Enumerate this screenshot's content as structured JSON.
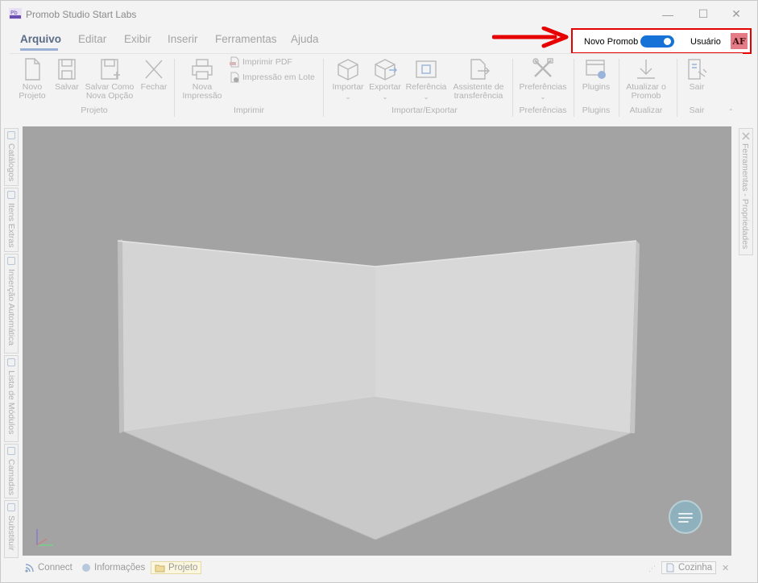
{
  "window": {
    "title": "Promob Studio Start Labs",
    "logo_text": "Pb",
    "min_glyph": "—",
    "max_glyph": "☐",
    "close_glyph": "✕"
  },
  "menu": {
    "tabs": [
      "Arquivo",
      "Editar",
      "Exibir",
      "Inserir",
      "Ferramentas",
      "Ajuda"
    ],
    "active": "Arquivo"
  },
  "header_right": {
    "novo_promob_label": "Novo Promob",
    "toggle_on": true,
    "user_label": "Usuário",
    "avatar_initials": "AF",
    "highlight_color": "#e60000",
    "toggle_color": "#1672d6"
  },
  "ribbon": {
    "groups": {
      "projeto": "Projeto",
      "imprimir": "Imprimir",
      "importar_exportar": "Importar/Exportar",
      "preferencias": "Preferências",
      "plugins": "Plugins",
      "atualizar": "Atualizar",
      "sair": "Sair"
    },
    "buttons": {
      "novo_projeto": [
        "Novo",
        "Projeto"
      ],
      "salvar": "Salvar",
      "salvar_como": [
        "Salvar Como",
        "Nova Opção"
      ],
      "fechar": "Fechar",
      "nova_impressao": [
        "Nova",
        "Impressão"
      ],
      "imprimir_pdf": "Imprimir PDF",
      "impressao_lote": "Impressão em Lote",
      "importar": "Importar",
      "exportar": "Exportar",
      "referencia": "Referência",
      "assistente": [
        "Assistente de",
        "transferência"
      ],
      "preferencias": "Preferências",
      "plugins": "Plugins",
      "atualizar": [
        "Atualizar o",
        "Promob"
      ],
      "sair": "Sair"
    }
  },
  "left_dock": [
    "Catálogos",
    "Itens Extras",
    "Inserção Automática",
    "Lista de Módulos",
    "Camadas",
    "Substituir"
  ],
  "right_dock": "Ferramentas - Propriedades",
  "statusbar": {
    "connect": "Connect",
    "informacoes": "Informações",
    "projeto": "Projeto",
    "cozinha": "Cozinha",
    "close_glyph": "✕"
  }
}
